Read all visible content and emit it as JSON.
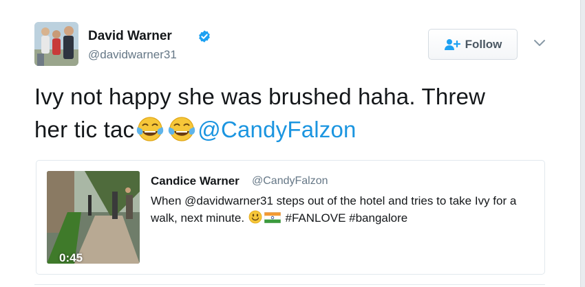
{
  "author": {
    "name": "David Warner",
    "handle": "@davidwarner31",
    "verified_icon": "verified-badge-icon"
  },
  "follow_button": {
    "label": "Follow",
    "icon": "add-person-icon"
  },
  "menu_icon": "chevron-down-icon",
  "tweet": {
    "text_line1": "Ivy not happy she was brushed haha. Threw",
    "text_line2": "her tic tac",
    "emojis": [
      "face-with-tears-of-joy",
      "face-with-tears-of-joy"
    ],
    "mention": "@CandyFalzon"
  },
  "quoted_tweet": {
    "name": "Candice Warner",
    "handle": "@CandyFalzon",
    "text_part1": "When @davidwarner31 steps out of the hotel and tries to take Ivy for a walk, next minute.",
    "emojis": [
      "smiling-face",
      "flag-india"
    ],
    "text_part2": "#FANLOVE #bangalore",
    "video_duration": "0:45"
  },
  "colors": {
    "link": "#1b95e0",
    "verified": "#1da1f2",
    "text": "#14171a",
    "secondary": "#657786",
    "border": "#e1e8ed"
  }
}
